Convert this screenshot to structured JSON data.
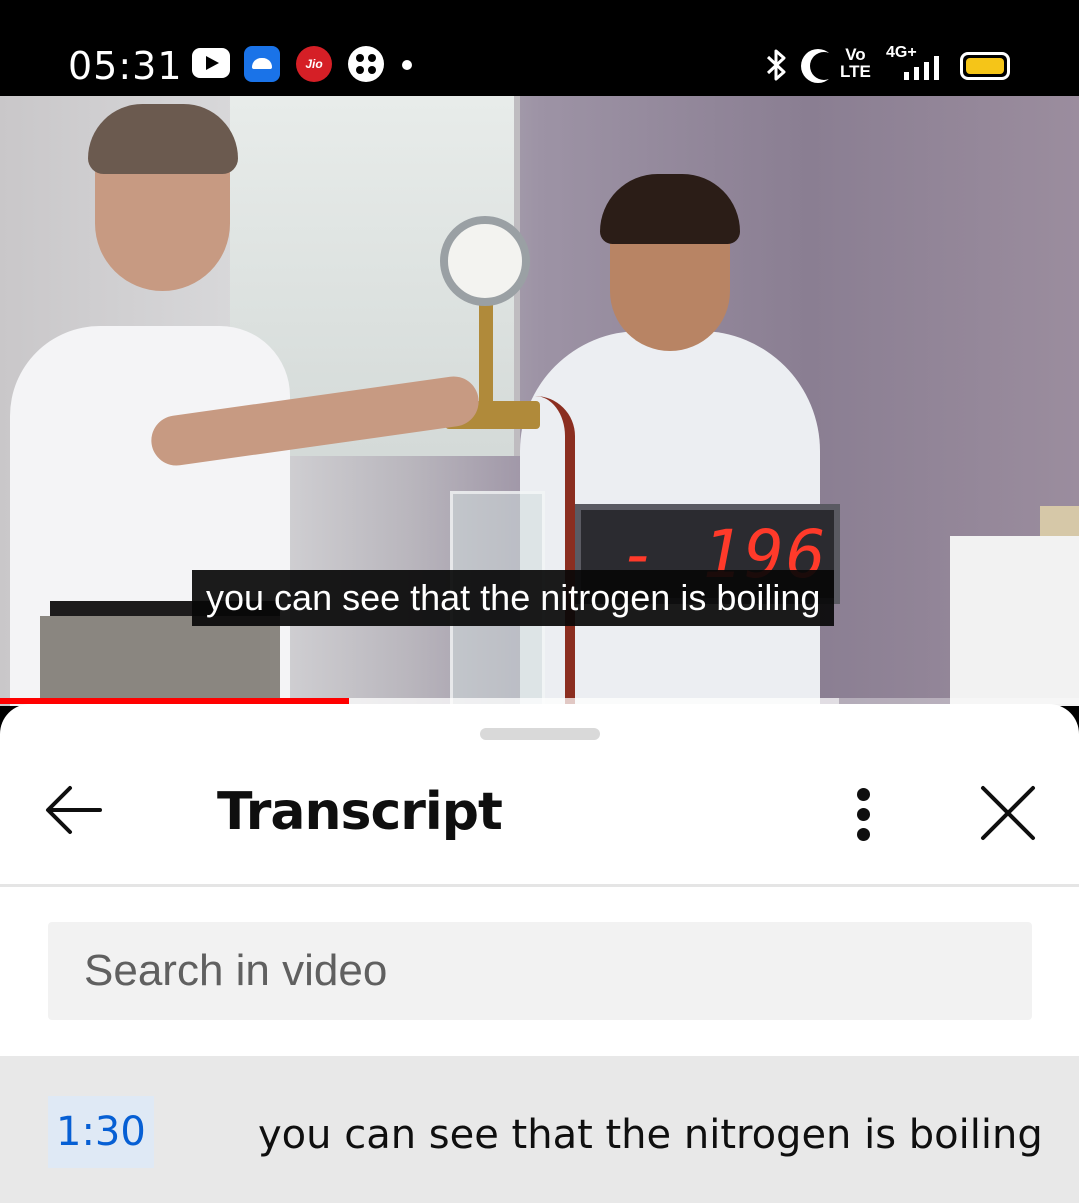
{
  "status_bar": {
    "time": "05:31",
    "carrier_logo": "Jio",
    "volte_top": "Vo",
    "volte_bottom": "LTE",
    "network": "4G+",
    "icons": [
      "youtube-icon",
      "android-icon",
      "jio-icon",
      "fan-icon",
      "dot-icon",
      "bluetooth-icon",
      "moon-icon",
      "signal-icon",
      "battery-icon"
    ]
  },
  "video": {
    "caption": "you can see that the nitrogen is boiling",
    "display_reading": "- 196",
    "progress_played_fraction": 0.323,
    "progress_buffered_fraction": 0.778
  },
  "transcript": {
    "title": "Transcript",
    "search_placeholder": "Search in video",
    "segments": [
      {
        "timestamp": "1:30",
        "text": "you can see that the nitrogen is boiling"
      }
    ]
  },
  "colors": {
    "accent_red": "#ff0000",
    "link_blue": "#065fd4",
    "battery_yellow": "#f5c518"
  }
}
